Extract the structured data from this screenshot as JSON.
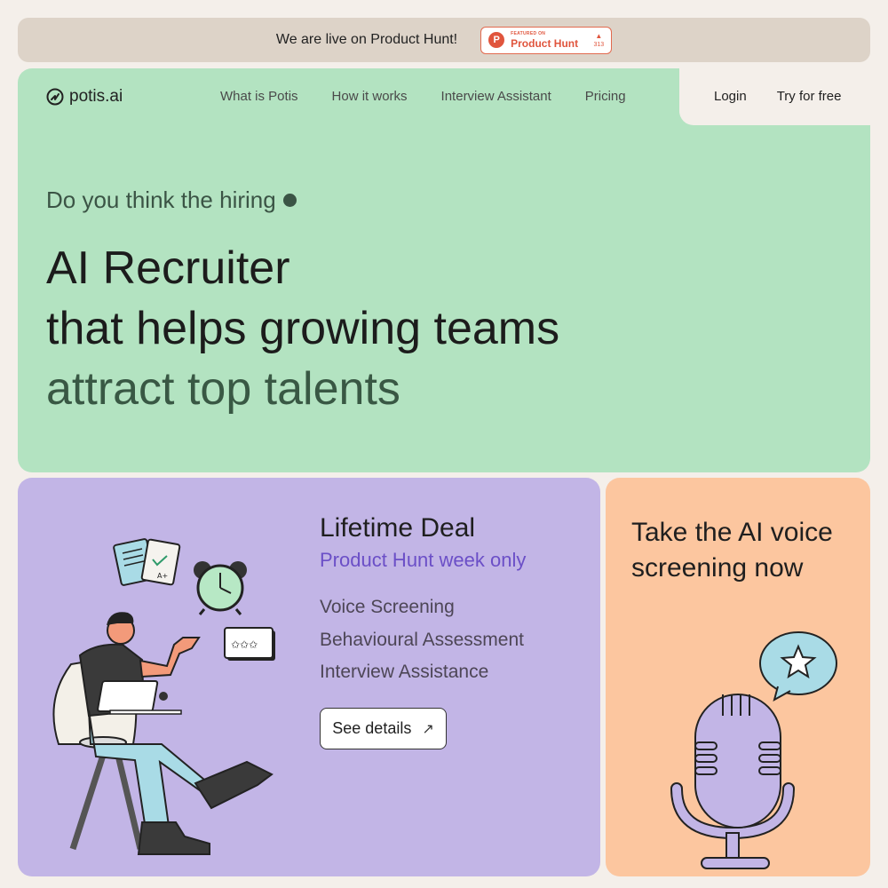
{
  "announcement": {
    "text": "We are live on Product Hunt!",
    "badge": {
      "featured": "FEATURED ON",
      "name": "Product Hunt",
      "votes": "313"
    }
  },
  "header": {
    "logo_text": "potis.ai",
    "nav": [
      "What is Potis",
      "How it works",
      "Interview Assistant",
      "Pricing"
    ],
    "login": "Login",
    "try_free": "Try for free"
  },
  "hero": {
    "kicker": "Do you think the hiring",
    "line1": "AI Recruiter",
    "line2": "that helps growing teams",
    "line3": "attract top talents"
  },
  "deal": {
    "title": "Lifetime Deal",
    "subtitle": "Product Hunt week only",
    "features": [
      "Voice Screening",
      "Behavioural Assessment",
      "Interview Assistance"
    ],
    "button": "See details"
  },
  "voice": {
    "title": "Take the AI voice screening now"
  },
  "colors": {
    "hero_bg": "#b3e3c1",
    "deal_bg": "#c2b5e6",
    "voice_bg": "#fcc69f",
    "accent_purple": "#6b4fc7",
    "product_hunt": "#e0553d"
  }
}
